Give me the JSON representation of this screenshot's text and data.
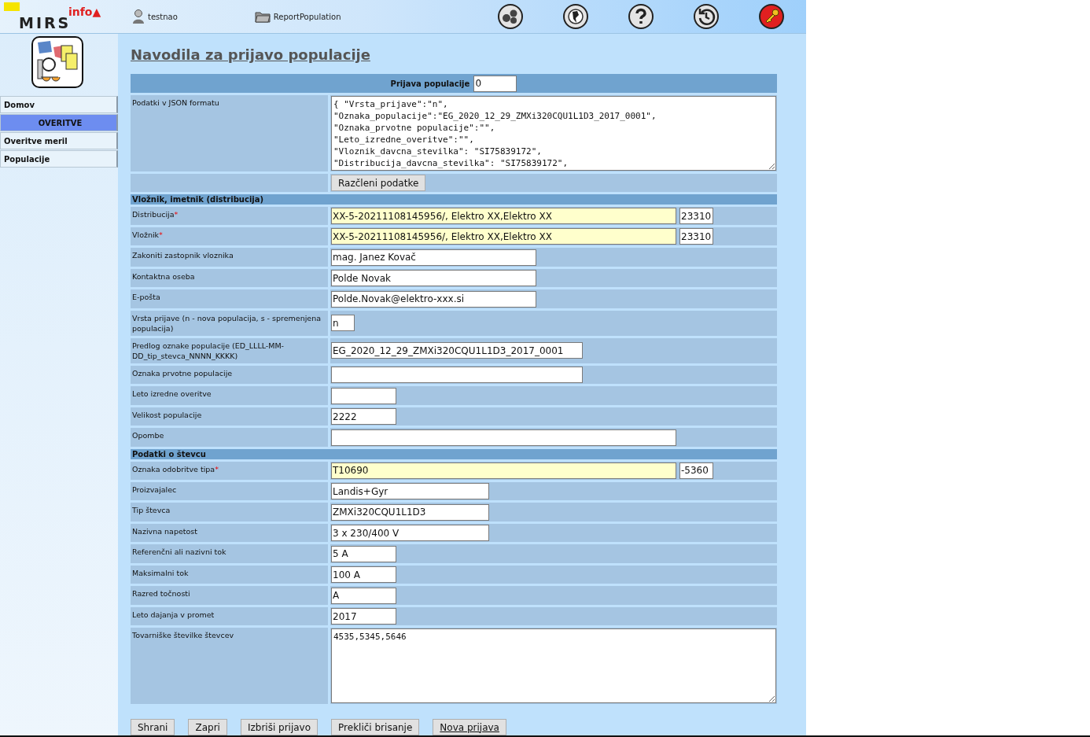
{
  "header": {
    "logo": {
      "name": "MIRS",
      "badge": "info▲"
    },
    "user": "testnao",
    "report": "ReportPopulation",
    "tools": [
      {
        "kind": "gears"
      },
      {
        "kind": "globe"
      },
      {
        "kind": "help"
      },
      {
        "kind": "history"
      },
      {
        "kind": "logout"
      }
    ]
  },
  "sidebar": {
    "items": [
      {
        "label": "Domov",
        "kind": "link"
      },
      {
        "label": "OVERITVE",
        "kind": "heading"
      },
      {
        "label": "Overitve meril",
        "kind": "link"
      },
      {
        "label": "Populacije",
        "kind": "link"
      }
    ]
  },
  "page_title": "Navodila za prijavo populacije",
  "form": {
    "rows": [
      {
        "kind": "title-input",
        "label": "Prijava populacije",
        "value": "0"
      },
      {
        "kind": "json",
        "label": "Podatki v JSON formatu",
        "value": "{ \"Vrsta_prijave\":\"n\",\n\"Oznaka_populacije\":\"EG_2020_12_29_ZMXi320CQU1L1D3_2017_0001\",\n\"Oznaka_prvotne populacije\":\"\",\n\"Leto_izredne_overitve\":\"\",\n\"Vloznik_davcna_stevilka\": \"SI75839172\",\n\"Distribucija_davcna_stevilka\": \"SI75839172\","
      },
      {
        "kind": "action",
        "label": "Razčleni podatke"
      },
      {
        "kind": "section",
        "label": "Vložnik, imetnik (distribucija)"
      },
      {
        "kind": "lookup",
        "label": "Distribucija",
        "required_mark": "*",
        "value": "XX-5-20211108145956/, Elektro XX,Elektro XX",
        "code": "23310"
      },
      {
        "kind": "lookup",
        "label": "Vložnik",
        "required_mark": "*",
        "value": "XX-5-20211108145956/, Elektro XX,Elektro XX",
        "code": "23310"
      },
      {
        "kind": "wide",
        "label": "Zakoniti zastopnik vloznika",
        "value": "mag. Janez Kovač"
      },
      {
        "kind": "wide",
        "label": "Kontaktna oseba",
        "value": "Polde Novak"
      },
      {
        "kind": "wide",
        "label": "E-pošta",
        "value": "Polde.Novak@elektro-xxx.si"
      },
      {
        "kind": "tiny",
        "label": "Vrsta prijave (n - nova populacija, s - spremenjena populacija)",
        "value": "n"
      },
      {
        "kind": "wider",
        "label": "Predlog oznake populacije (ED_LLLL-MM-DD_tip_stevca_NNNN_KKKK)",
        "value": "EG_2020_12_29_ZMXi320CQU1L1D3_2017_0001"
      },
      {
        "kind": "wider",
        "label": "Oznaka prvotne populacije"
      },
      {
        "kind": "short",
        "label": "Leto izredne overitve"
      },
      {
        "kind": "short",
        "label": "Velikost populacije",
        "value": "2222"
      },
      {
        "kind": "full",
        "label": "Opombe"
      },
      {
        "kind": "section",
        "label": "Podatki o števcu"
      },
      {
        "kind": "lookup",
        "label": "Oznaka odobritve tipa",
        "required_mark": "*",
        "value": "T10690",
        "code": "-5360"
      },
      {
        "kind": "medium",
        "label": "Proizvajalec",
        "value": "Landis+Gyr"
      },
      {
        "kind": "medium",
        "label": "Tip števca",
        "value": "ZMXi320CQU1L1D3"
      },
      {
        "kind": "medium",
        "label": "Nazivna napetost",
        "value": "3 x 230/400 V"
      },
      {
        "kind": "short",
        "label": "Referenčni ali nazivni tok",
        "value": "5 A"
      },
      {
        "kind": "short",
        "label": "Maksimalni tok",
        "value": "100 A"
      },
      {
        "kind": "short",
        "label": "Razred točnosti",
        "value": "A"
      },
      {
        "kind": "short",
        "label": "Leto dajanja v promet",
        "value": "2017"
      },
      {
        "kind": "multiline",
        "label": "Tovarniške številke števcev",
        "value": "4535,5345,5646"
      }
    ]
  },
  "buttons": [
    {
      "label": "Shrani",
      "underlined": false
    },
    {
      "label": "Zapri",
      "underlined": false
    },
    {
      "label": "Izbriši prijavo",
      "underlined": false
    },
    {
      "label": "Prekliči brisanje",
      "underlined": false
    },
    {
      "label": "Nova prijava",
      "underlined": true
    }
  ]
}
